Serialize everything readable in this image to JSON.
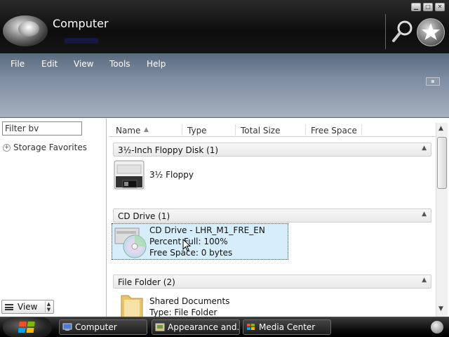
{
  "window": {
    "title": "Computer"
  },
  "menu": [
    "File",
    "Edit",
    "View",
    "Tools",
    "Help"
  ],
  "sidebar": {
    "filter_value": "Filter bv",
    "favorites_label": "Storage Favorites",
    "view_label": "View"
  },
  "columns": [
    "Name",
    "Type",
    "Total Size",
    "Free Space"
  ],
  "groups": [
    {
      "label": "3½-Inch Floppy Disk (1)",
      "items": [
        {
          "lines": [
            "3½ Floppy"
          ]
        }
      ]
    },
    {
      "label": "CD Drive (1)",
      "items": [
        {
          "lines": [
            "CD Drive - LHR_M1_FRE_EN",
            "Percent Full: 100%",
            "Free Space: 0 bytes"
          ],
          "selected": true
        }
      ]
    },
    {
      "label": "File Folder (2)",
      "items": [
        {
          "lines": [
            "Shared Documents",
            "Type: File Folder"
          ]
        }
      ]
    }
  ],
  "taskbar": {
    "tasks": [
      "Computer",
      "Appearance and...",
      "Media Center"
    ]
  },
  "colors": {
    "titlebar": "#111111",
    "menubar": "#7e8da1",
    "selection": "#d6eefc"
  }
}
